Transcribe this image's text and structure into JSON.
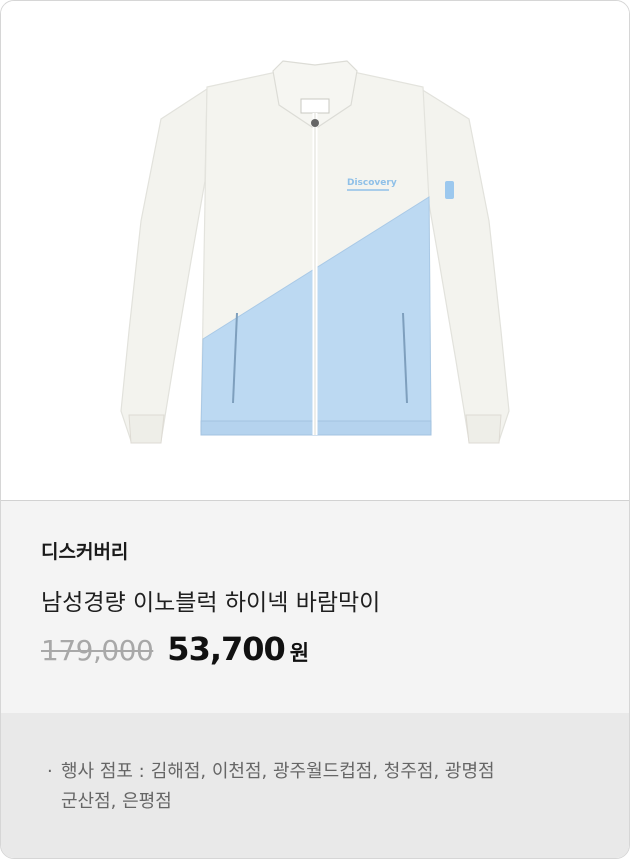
{
  "product": {
    "image_alt": "남성경량 이노블럭 하이넥 바람막이",
    "jacket_logo_text": "Discovery",
    "brand": "디스커버리",
    "name": "남성경량 이노블럭 하이넥 바람막이",
    "original_price": "179,000",
    "sale_price": "53,700",
    "currency": "원"
  },
  "event": {
    "bullet": "·",
    "label": "행사 점포 :",
    "stores_line1": "김해점, 이천점, 광주월드컵점, 청주점, 광명점",
    "stores_line2": "군산점, 은평점"
  },
  "colors": {
    "jacket_white": "#f4f4ef",
    "jacket_blue": "#bcd9f2",
    "info_bg": "#f4f4f4",
    "event_bg": "#e9e9e9",
    "original_price": "#a8a8a8",
    "sale_price": "#111111"
  }
}
